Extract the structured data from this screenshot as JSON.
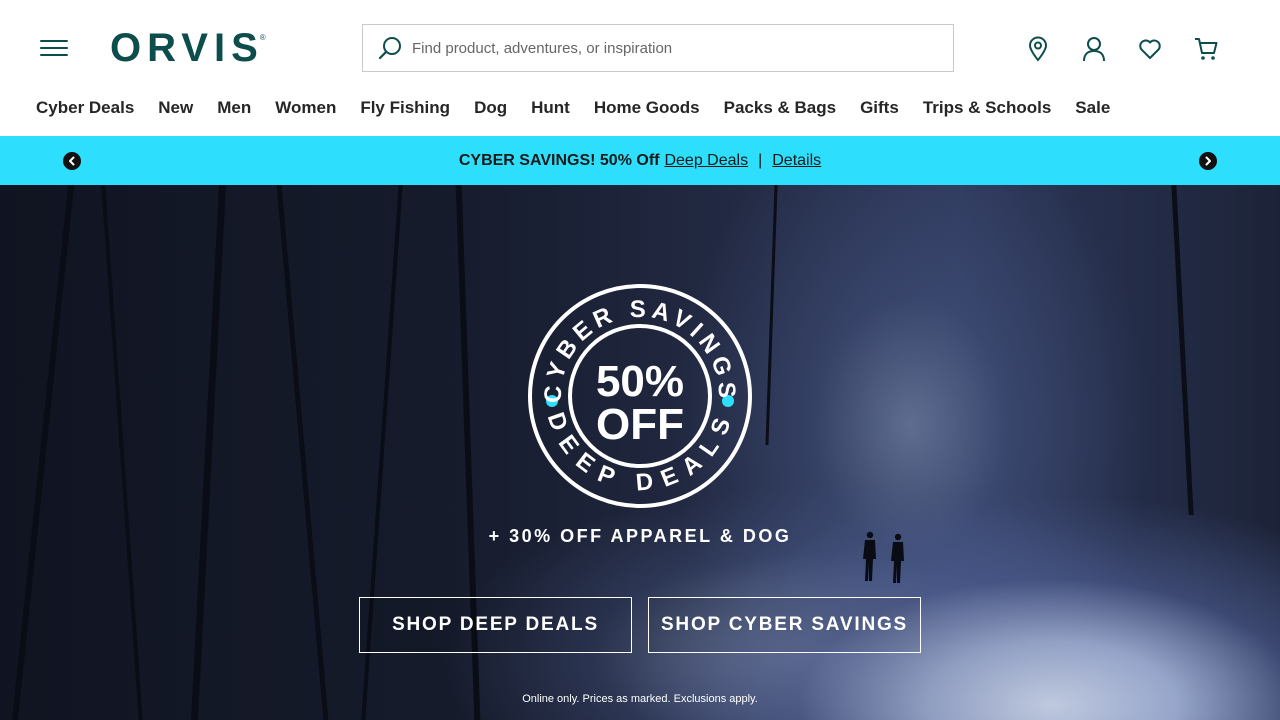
{
  "brand": {
    "logo_text": "ORVIS",
    "logo_mark": "®",
    "brand_color": "#0d4e4d"
  },
  "search": {
    "placeholder": "Find product, adventures, or inspiration",
    "value": ""
  },
  "utility_icons": [
    "location-pin-icon",
    "account-icon",
    "heart-icon",
    "cart-icon"
  ],
  "nav": {
    "items": [
      {
        "label": "Cyber Deals"
      },
      {
        "label": "New"
      },
      {
        "label": "Men"
      },
      {
        "label": "Women"
      },
      {
        "label": "Fly Fishing"
      },
      {
        "label": "Dog"
      },
      {
        "label": "Hunt"
      },
      {
        "label": "Home Goods"
      },
      {
        "label": "Packs & Bags"
      },
      {
        "label": "Gifts"
      },
      {
        "label": "Trips & Schools"
      },
      {
        "label": "Sale"
      }
    ]
  },
  "promo_bar": {
    "bg_color": "#2ddffc",
    "headline": "CYBER SAVINGS! 50% Off",
    "link_1": "Deep Deals",
    "separator": "|",
    "link_2": "Details"
  },
  "hero": {
    "badge": {
      "top_arc": "CYBER SAVINGS",
      "bottom_arc": "DEEP DEALS",
      "line_1": "50%",
      "line_2": "OFF",
      "accent_color": "#2ddffc"
    },
    "subheadline": "+ 30% OFF APPAREL & DOG",
    "cta_1": "SHOP DEEP DEALS",
    "cta_2": "SHOP CYBER SAVINGS",
    "fine_print": "Online only. Prices as marked. Exclusions apply."
  }
}
